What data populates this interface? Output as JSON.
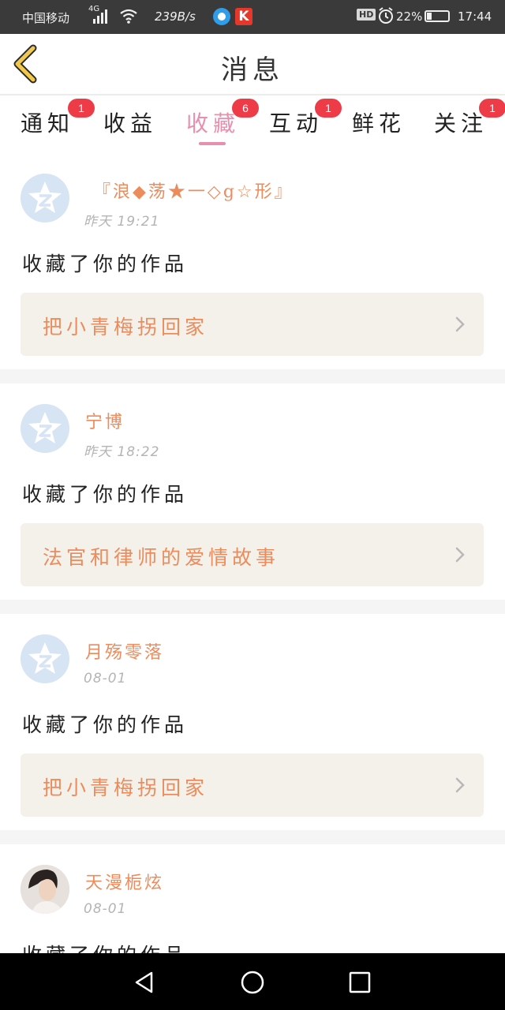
{
  "status_bar": {
    "carrier": "中国移动",
    "network": "4G",
    "speed": "239B/s",
    "hd": "HD",
    "battery": "22%",
    "time": "17:44",
    "icons": [
      "signal-icon",
      "wifi-icon",
      "app-icon",
      "app-icon",
      "alarm-icon",
      "battery-icon"
    ]
  },
  "header": {
    "back_icon": "chevron-left-icon",
    "title": "消息"
  },
  "tabs": [
    {
      "label": "通知",
      "badge": "1",
      "active": false
    },
    {
      "label": "收益",
      "badge": "",
      "active": false
    },
    {
      "label": "收藏",
      "badge": "6",
      "active": true
    },
    {
      "label": "互动",
      "badge": "1",
      "active": false
    },
    {
      "label": "鲜花",
      "badge": "",
      "active": false
    },
    {
      "label": "关注",
      "badge": "1",
      "active": false
    }
  ],
  "messages": [
    {
      "user": "『浪◆荡★一◇g☆形』",
      "time": "昨天  19:21",
      "action": "收藏了你的作品",
      "work": "把小青梅拐回家",
      "avatar": "default-avatar-icon"
    },
    {
      "user": "宁博",
      "time": "昨天  18:22",
      "action": "收藏了你的作品",
      "work": "法官和律师的爱情故事",
      "avatar": "default-avatar-icon"
    },
    {
      "user": "月殇零落",
      "time": "08-01",
      "action": "收藏了你的作品",
      "work": "把小青梅拐回家",
      "avatar": "default-avatar-icon"
    },
    {
      "user": "天漫栀炫",
      "time": "08-01",
      "action": "收藏了你的作品",
      "work": "",
      "avatar": "user-photo"
    }
  ],
  "colors": {
    "accent_pink": "#e98fae",
    "name_orange": "#ec8b5c",
    "badge_red": "#ee3b48",
    "back_yellow": "#f2c94c"
  },
  "nav_bar": {
    "icons": [
      "back-triangle-icon",
      "home-circle-icon",
      "recents-square-icon"
    ]
  }
}
